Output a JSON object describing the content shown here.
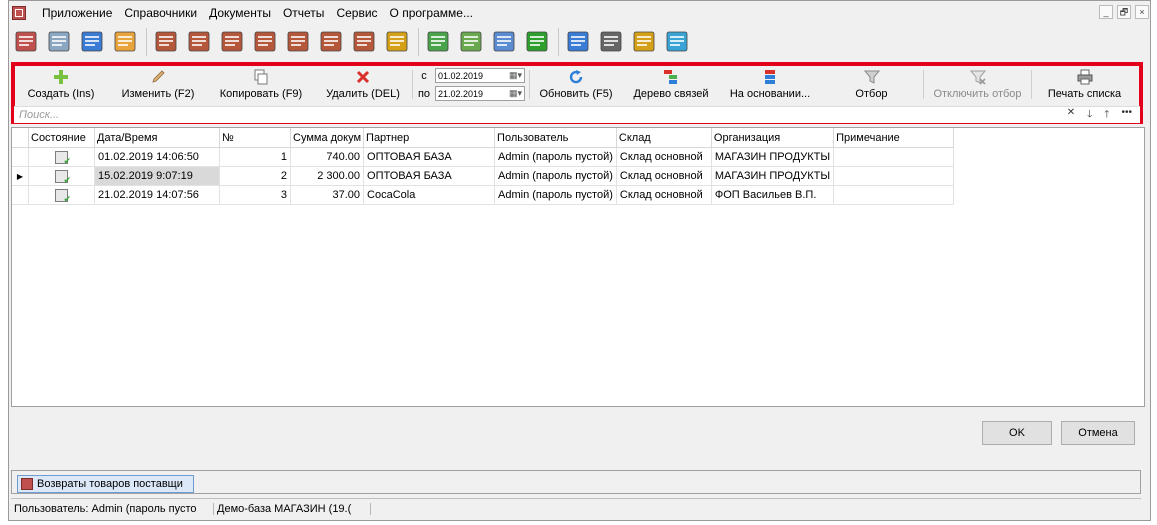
{
  "menu": [
    "Приложение",
    "Справочники",
    "Документы",
    "Отчеты",
    "Сервис",
    "О программе..."
  ],
  "window_controls": [
    "_",
    "🗗",
    "×"
  ],
  "icon_toolbar": [
    {
      "name": "exit-icon",
      "color": "#c0504d"
    },
    {
      "name": "lock-icon",
      "color": "#8aa6c1"
    },
    {
      "name": "books-icon",
      "color": "#3a7bd5"
    },
    {
      "name": "users-icon",
      "color": "#e8a33d"
    },
    {
      "name": "document-star-icon",
      "color": "#b5573a"
    },
    {
      "name": "document-add-icon",
      "color": "#b5573a"
    },
    {
      "name": "document-remove-icon",
      "color": "#b5573a"
    },
    {
      "name": "basket-star-icon",
      "color": "#b5573a"
    },
    {
      "name": "basket-add-icon",
      "color": "#b5573a"
    },
    {
      "name": "basket-remove-icon",
      "color": "#b5573a"
    },
    {
      "name": "basket-transfer-icon",
      "color": "#b5573a"
    },
    {
      "name": "coins-icon",
      "color": "#d4a017"
    },
    {
      "name": "cash-icon",
      "color": "#4aa34a"
    },
    {
      "name": "truck-icon",
      "color": "#6aa84f"
    },
    {
      "name": "calculator-icon",
      "color": "#5b8bd0"
    },
    {
      "name": "spellcheck-icon",
      "color": "#2e9e2e"
    },
    {
      "name": "export-icon",
      "color": "#3a7bd5"
    },
    {
      "name": "printer-icon",
      "color": "#666666"
    },
    {
      "name": "scales-icon",
      "color": "#d4a017"
    },
    {
      "name": "upload-box-icon",
      "color": "#3aa3d5"
    }
  ],
  "actions": {
    "create": "Создать (Ins)",
    "edit": "Изменить (F2)",
    "copy": "Копировать (F9)",
    "delete": "Удалить (DEL)",
    "refresh": "Обновить (F5)",
    "tree": "Дерево связей",
    "based_on": "На основании...",
    "filter": "Отбор",
    "unfilter": "Отключить отбор",
    "print": "Печать списка"
  },
  "dates": {
    "from_label": "с",
    "to_label": "по",
    "from": "01.02.2019",
    "to": "21.02.2019"
  },
  "search": {
    "placeholder": "Поиск..."
  },
  "columns": [
    "Состояние",
    "Дата/Время",
    "№",
    "Сумма докум",
    "Партнер",
    "Пользователь",
    "Склад",
    "Организация",
    "Примечание"
  ],
  "rows": [
    {
      "datetime": "01.02.2019 14:06:50",
      "num": "1",
      "sum": "740.00",
      "partner": "ОПТОВАЯ БАЗА",
      "user": "Admin (пароль пустой)",
      "warehouse": "Склад основной",
      "org": "МАГАЗИН ПРОДУКТЫ",
      "note": ""
    },
    {
      "datetime": "15.02.2019 9:07:19",
      "num": "2",
      "sum": "2 300.00",
      "partner": "ОПТОВАЯ БАЗА",
      "user": "Admin (пароль пустой)",
      "warehouse": "Склад основной",
      "org": "МАГАЗИН ПРОДУКТЫ",
      "note": ""
    },
    {
      "datetime": "21.02.2019 14:07:56",
      "num": "3",
      "sum": "37.00",
      "partner": "CocaCola",
      "user": "Admin (пароль пустой)",
      "warehouse": "Склад основной",
      "org": "ФОП Васильев В.П.",
      "note": ""
    }
  ],
  "buttons": {
    "ok": "OK",
    "cancel": "Отмена"
  },
  "task_tab": "Возвраты товаров поставщи",
  "status": {
    "user": "Пользователь: Admin (пароль пусто",
    "db": "Демо-база МАГАЗИН (19.("
  },
  "colors": {
    "highlight": "#e3001b",
    "selection": "#d9d9d9"
  }
}
